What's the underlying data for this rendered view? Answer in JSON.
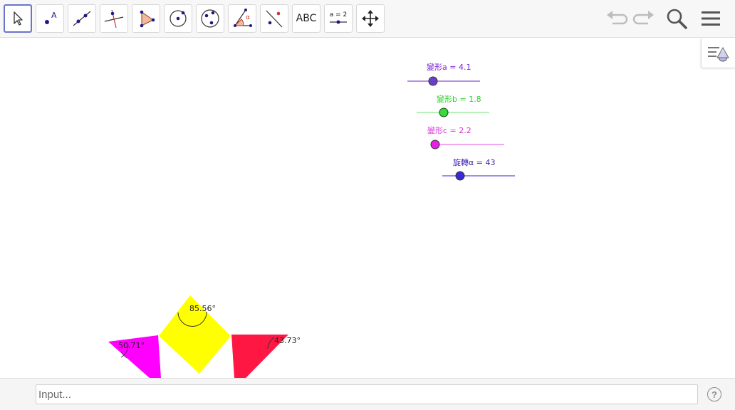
{
  "toolbar": {
    "tools": [
      {
        "name": "move",
        "label": ""
      },
      {
        "name": "point",
        "label": "A"
      },
      {
        "name": "line",
        "label": ""
      },
      {
        "name": "perpendicular-line",
        "label": ""
      },
      {
        "name": "polygon",
        "label": ""
      },
      {
        "name": "circle-center-point",
        "label": ""
      },
      {
        "name": "ellipse",
        "label": ""
      },
      {
        "name": "angle",
        "label": "α"
      },
      {
        "name": "reflect-about-line",
        "label": ""
      },
      {
        "name": "text",
        "label": "ABC"
      },
      {
        "name": "slider",
        "label": "a = 2"
      },
      {
        "name": "move-graphics-view",
        "label": ""
      }
    ],
    "active_tool": "move"
  },
  "sliders": [
    {
      "label": "變形a = 4.1",
      "color": "#7b1fd6",
      "dot_color": "#6a3ec9",
      "value": 4.1
    },
    {
      "label": "變形b = 1.8",
      "color": "#33cc33",
      "dot_color": "#33dd33",
      "value": 1.8
    },
    {
      "label": "變形c = 2.2",
      "color": "#d633d6",
      "dot_color": "#e61ee6",
      "value": 2.2
    },
    {
      "label": "旋轉α = 43",
      "color": "#3a1fa8",
      "dot_color": "#3a2ad6",
      "value": 43
    }
  ],
  "angles": [
    {
      "label": "85.56°"
    },
    {
      "label": "50.71°"
    },
    {
      "label": "43.73°"
    }
  ],
  "shapes": {
    "square_color": "#ffff00",
    "left_triangle_color": "#ff00ff",
    "right_triangle_color": "#ff0040"
  },
  "input_bar": {
    "placeholder": "Input...",
    "help_label": "?"
  }
}
